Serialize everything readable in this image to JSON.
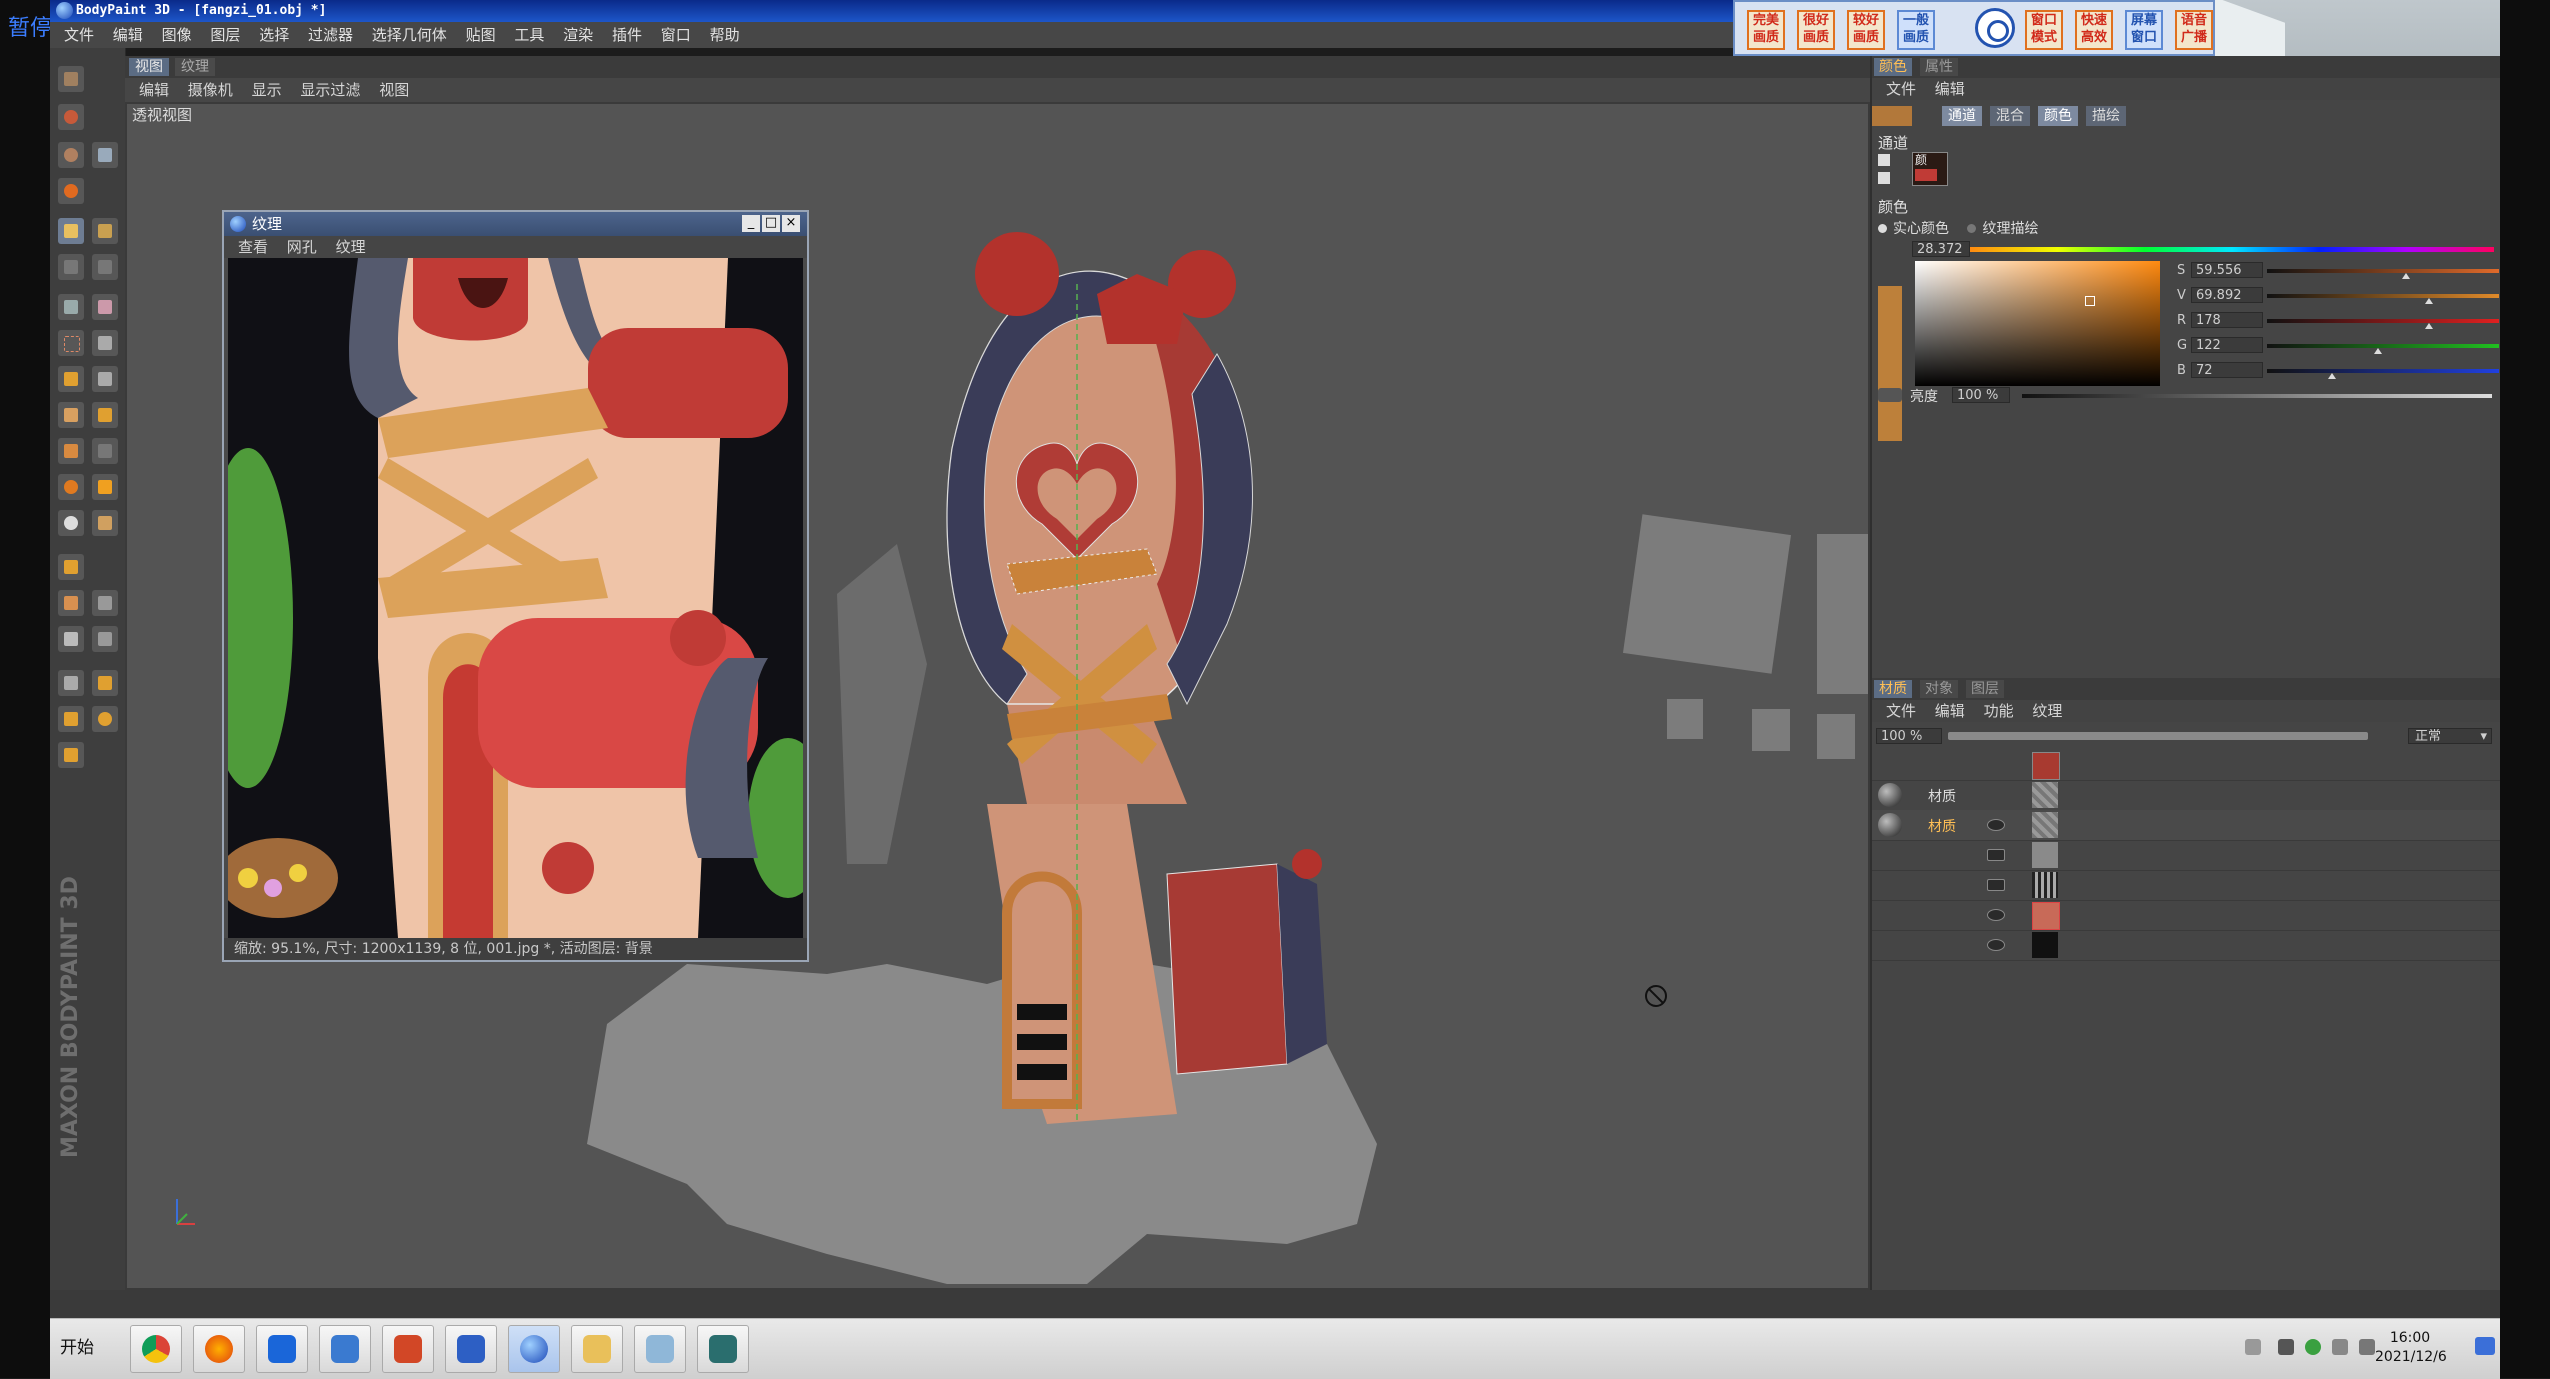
{
  "overlay": {
    "pause_label": "暂停"
  },
  "window": {
    "title": "BodyPaint 3D - [fangzi_01.obj *]"
  },
  "menubar": [
    "文件",
    "编辑",
    "图像",
    "图层",
    "选择",
    "过滤器",
    "选择几何体",
    "贴图",
    "工具",
    "渲染",
    "插件",
    "窗口",
    "帮助"
  ],
  "quickbar": {
    "buttons": [
      "完美画质",
      "很好画质",
      "较好画质",
      "一般画质",
      "窗口模式",
      "快速高效",
      "屏幕窗口",
      "语音广播"
    ]
  },
  "viewport": {
    "tabs": [
      "视图",
      "纹理"
    ],
    "menu": [
      "编辑",
      "摄像机",
      "显示",
      "显示过滤",
      "视图"
    ],
    "label": "透视视图"
  },
  "texture_window": {
    "title": "纹理",
    "menu": [
      "查看",
      "网孔",
      "纹理"
    ],
    "status": "缩放: 95.1%, 尺寸: 1200x1139, 8 位, 001.jpg *, 活动图层: 背景"
  },
  "color_panel": {
    "tabs": [
      "颜色",
      "属性"
    ],
    "menu": [
      "文件",
      "编辑"
    ],
    "channel_tabs": [
      "通道",
      "混合",
      "颜色",
      "描绘"
    ],
    "channel_label": "通道",
    "channel_swatch_label": "颜",
    "color_label": "颜色",
    "mode_options": [
      "实心颜色",
      "纹理描绘"
    ],
    "hue_value": "28.372",
    "sliders": [
      {
        "label": "S",
        "value": "59.556",
        "color": "#e06a2a",
        "pos": 0.6
      },
      {
        "label": "V",
        "value": "69.892",
        "color": "#e08a2a",
        "pos": 0.7
      },
      {
        "label": "R",
        "value": "178",
        "color": "#e02020",
        "pos": 0.7
      },
      {
        "label": "G",
        "value": "122",
        "color": "#20c020",
        "pos": 0.48
      },
      {
        "label": "B",
        "value": "72",
        "color": "#2040e0",
        "pos": 0.28
      }
    ],
    "brightness_label": "亮度",
    "brightness_value": "100 %",
    "current_color": "#b2783a"
  },
  "material_panel": {
    "tabs": [
      "材质",
      "对象",
      "图层"
    ],
    "menu": [
      "文件",
      "编辑",
      "功能",
      "纹理"
    ],
    "opacity": "100 %",
    "blend_mode": "正常",
    "materials": [
      {
        "name": "材质",
        "active": false
      },
      {
        "name": "材质",
        "active": true
      }
    ]
  },
  "logo": {
    "text": "MAXON BODYPAINT 3D"
  },
  "taskbar": {
    "start_label": "开始",
    "apps": [
      "chrome-icon",
      "firefox-icon",
      "feishu-icon",
      "sogou-icon",
      "powerpoint-icon",
      "p-icon",
      "bodypaint-icon",
      "explorer-icon",
      "tablet-icon",
      "g-icon"
    ],
    "clock_time": "16:00",
    "clock_date": "2021/12/6"
  }
}
